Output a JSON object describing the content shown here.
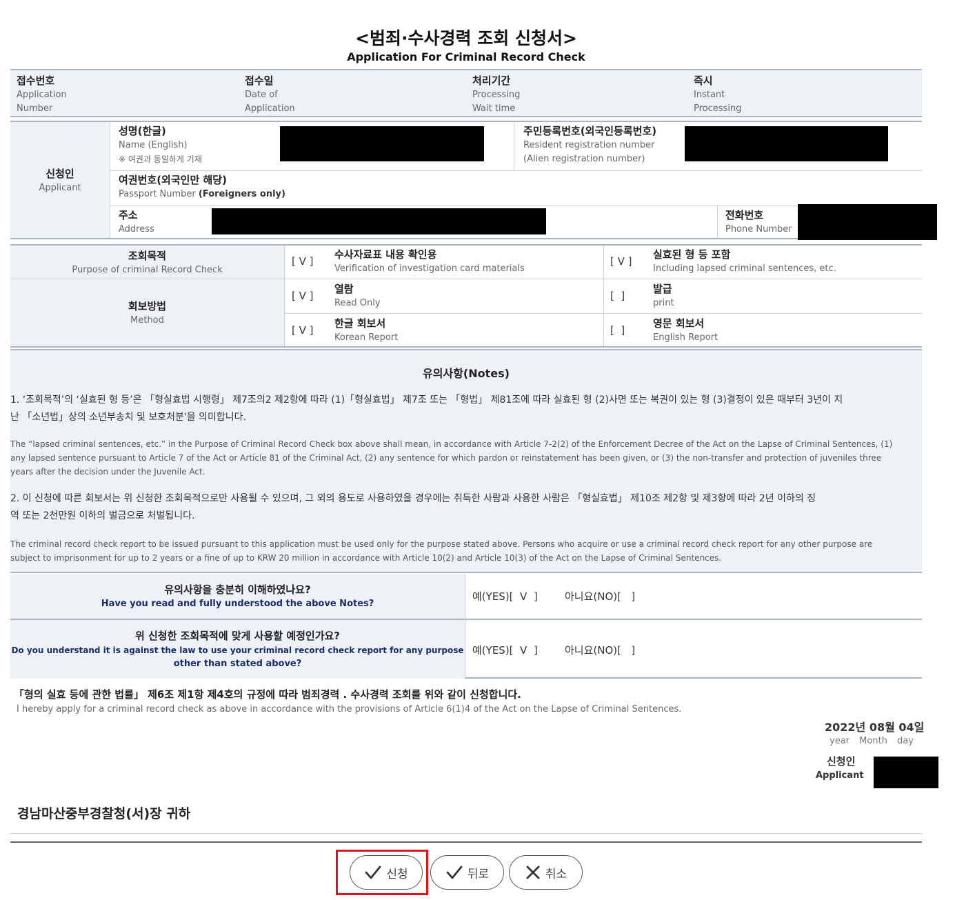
{
  "form": {
    "title": "<범죄·수사경력 조회 신청서>",
    "subtitle": "Application For Criminal Record Check"
  },
  "receipt": [
    {
      "ko": "접수번호",
      "en1": "Application",
      "en2": "Number"
    },
    {
      "ko": "접수일",
      "en1": "Date of",
      "en2": "Application"
    },
    {
      "ko": "처리기간",
      "en1": "Processing",
      "en2": "Wait time"
    },
    {
      "ko": "즉시",
      "en1": "Instant",
      "en2": "Processing"
    }
  ],
  "applicant": {
    "label_ko": "신청인",
    "label_en": "Applicant",
    "name_ko": "성명(한글)",
    "name_en": "Name (English)",
    "name_note": "※ 여권과 동일하게 기재",
    "rrn_ko": "주민등록번호(외국인등록번호)",
    "rrn_en1": "Resident registration number",
    "rrn_en2": "(Alien registration number)",
    "passport_ko": "여권번호(외국인만 해당)",
    "passport_en": "Passport Number",
    "passport_en_bold": "(Foreigners only)",
    "address_ko": "주소",
    "address_en": "Address",
    "phone_ko": "전화번호",
    "phone_en": "Phone Number"
  },
  "purpose": {
    "label_ko": "조회목적",
    "label_en": "Purpose of criminal Record Check",
    "opt1_mark": "[ V ]",
    "opt1_ko": "수사자료표 내용 확인용",
    "opt1_en": "Verification of investigation card materials",
    "opt2_mark": "[ V ]",
    "opt2_ko": "실효된 형 등 포함",
    "opt2_en": "Including lapsed criminal sentences, etc."
  },
  "method": {
    "label_ko": "회보방법",
    "label_en": "Method",
    "read_mark": "[ V ]",
    "read_ko": "열람",
    "read_en": "Read Only",
    "print_mark": "[  ]",
    "print_ko": "발급",
    "print_en": "print",
    "korean_mark": "[ V ]",
    "korean_ko": "한글 회보서",
    "korean_en": "Korean Report",
    "english_mark": "[  ]",
    "english_ko": "영문 회보서",
    "english_en": "English Report"
  },
  "notes": {
    "title": "유의사항(Notes)",
    "n1_ko_1": "1. ‘조회목적’의 ‘실효된 형 등’은 「형실효법 시행령」 제7조의2 제2항에 따라 (1)「형실효법」 제7조 또는 「형법」 제81조에 따라 실효된 형 (2)사면 또는 복권이 있는 형 (3)결정이 있은 때부터 3년이 지",
    "n1_ko_2": "난 「소년법」상의 소년부송치 및 보호처분'을 의미합니다.",
    "n1_en_1": "The “lapsed criminal sentences, etc.” in the Purpose of Criminal Record Check box above shall mean, in accordance with Article 7-2(2) of the Enforcement Decree of the Act on the Lapse of Criminal Sentences, (1)",
    "n1_en_2": "any lapsed sentence pursuant to Article 7 of the Act or Article 81 of the Criminal Act, (2) any sentence for which pardon or reinstatement has been given, or (3) the non-transfer and protection of juveniles three",
    "n1_en_3": "years after the decision under the Juvenile Act.",
    "n2_ko_1": "2. 이 신청에 따른 회보서는 위 신청한 조회목적으로만 사용될 수 있으며, 그 외의 용도로 사용하였을 경우에는 취득한 사람과 사용한 사람은 「형실효법」 제10조 제2항 및 제3항에 따라 2년 이하의 징",
    "n2_ko_2": "역 또는 2천만원 이하의 벌금으로 처벌됩니다.",
    "n2_en_1": "The criminal record check report to be issued pursuant to this application must be used only for the purpose stated above. Persons who acquire or use a criminal record check report for any other purpose are",
    "n2_en_2": "subject to imprisonment for up to 2 years or a fine of up to KRW 20 million in accordance with Article 10(2) and Article 10(3) of the Act on the Lapse of Criminal Sentences."
  },
  "confirm": {
    "q1_ko": "유의사항을 충분히 이해하였나요?",
    "q1_en": "Have you read and fully understood the above Notes?",
    "q1_yes": "예(YES)[  V  ]",
    "q1_no": "아니요(NO)[   ]",
    "q2_ko": "위 신청한 조회목적에 맞게 사용할 예정인가요?",
    "q2_en1": "Do you understand it is against the law to use your criminal record check report for any purpose",
    "q2_en2": "other than stated above?",
    "q2_yes": "예(YES)[  V  ]",
    "q2_no": "아니요(NO)[   ]"
  },
  "declaration": {
    "ko": "「형의 실효 등에 관한 법률」 제6조 제1항 제4호의 규정에 따라 범죄경력 . 수사경력 조회를 위와 같이 신청합니다.",
    "en": "I hereby apply for a criminal record check as above in accordance with the provisions of Article 6(1)4 of the Act on the Lapse of Criminal Sentences.",
    "date": "2022년 08월 04일",
    "date_units": "year Month day",
    "signer_ko": "신청인",
    "signer_en": "Applicant"
  },
  "recipient": "경남마산중부경찰청(서)장 귀하",
  "buttons": {
    "apply": "신청",
    "back": "뒤로",
    "cancel": "취소"
  },
  "colors": {
    "header_bg": "#eef1f6",
    "border": "#a9b3c3",
    "question_text": "#1a2c6b",
    "highlight": "#e0151b"
  }
}
